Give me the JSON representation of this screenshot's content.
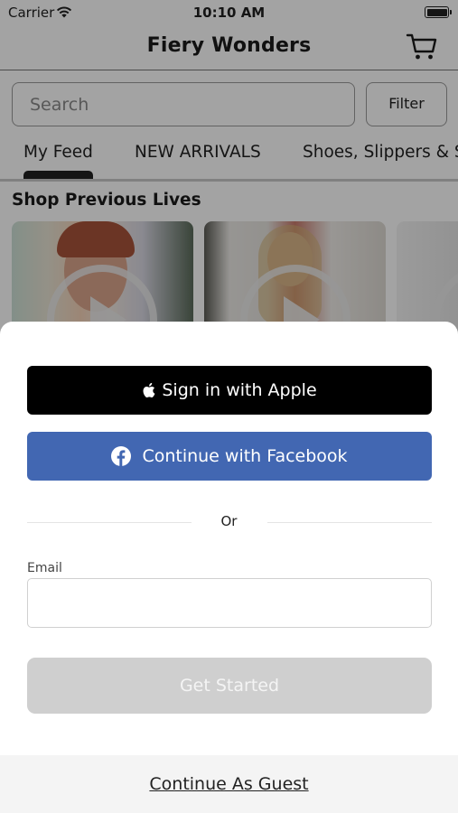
{
  "status_bar": {
    "carrier": "Carrier",
    "time": "10:10 AM"
  },
  "nav": {
    "title": "Fiery Wonders",
    "cart_icon": "cart-icon"
  },
  "search": {
    "placeholder": "Search",
    "filter_label": "Filter"
  },
  "tabs": [
    {
      "label": "My Feed",
      "selected": true
    },
    {
      "label": "NEW ARRIVALS",
      "selected": false
    },
    {
      "label": "Shoes, Slippers & S",
      "selected": false
    }
  ],
  "section": {
    "title": "Shop Previous Lives"
  },
  "sheet": {
    "apple_label": "Sign in with Apple",
    "facebook_label": "Continue with Facebook",
    "or_label": "Or",
    "email_label": "Email",
    "email_value": "",
    "get_started_label": "Get Started",
    "guest_label": "Continue As Guest"
  },
  "colors": {
    "apple_button": "#000000",
    "facebook_button": "#4267b2",
    "get_started_disabled": "#cfcfcf",
    "overlay": "rgba(0,0,0,0.36)"
  }
}
